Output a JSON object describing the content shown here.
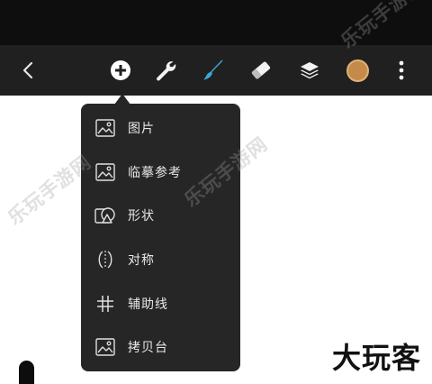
{
  "toolbar": {
    "items": [
      {
        "name": "back-button",
        "icon": "chevron-left-icon"
      },
      {
        "name": "add-button",
        "icon": "plus-circle-icon"
      },
      {
        "name": "actions-button",
        "icon": "wrench-icon"
      },
      {
        "name": "brush-button",
        "icon": "brush-icon"
      },
      {
        "name": "eraser-button",
        "icon": "eraser-icon"
      },
      {
        "name": "layers-button",
        "icon": "layers-icon"
      },
      {
        "name": "color-button",
        "icon": "color-swatch"
      },
      {
        "name": "more-button",
        "icon": "more-vertical-icon"
      }
    ],
    "active_brush_color": "#3aa9d8",
    "color_swatch": "#c58a4a"
  },
  "add_menu": {
    "items": [
      {
        "label": "图片",
        "icon": "image-icon"
      },
      {
        "label": "临摹参考",
        "icon": "image-reference-icon"
      },
      {
        "label": "形状",
        "icon": "shape-icon"
      },
      {
        "label": "对称",
        "icon": "symmetry-icon"
      },
      {
        "label": "辅助线",
        "icon": "grid-icon"
      },
      {
        "label": "拷贝台",
        "icon": "lightbox-icon"
      }
    ]
  },
  "watermark": {
    "text": "乐玩手游网"
  },
  "brand": {
    "text": "大玩客"
  }
}
